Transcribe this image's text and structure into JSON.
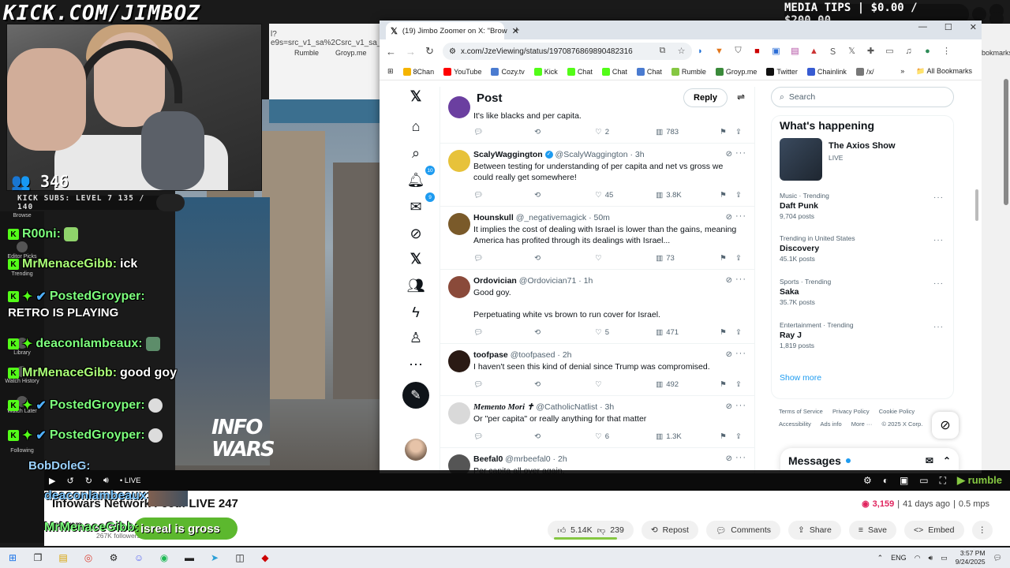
{
  "overlay": {
    "title": "KICK.COM/JIMBOZ",
    "viewer_count": "346",
    "subs_bar": "KICK SUBS: LEVEL 7  135 / 140",
    "media_tips": "MEDIA TIPS | $0.00 / $200.00",
    "retro_text": "RETRO IS PLAYING",
    "infowars_logo": "INFO WARS"
  },
  "chat_sidebar": [
    {
      "label": "Browse"
    },
    {
      "label": "Editor Picks"
    },
    {
      "label": "Trending"
    },
    {
      "label": "Library"
    },
    {
      "label": "Watch History"
    },
    {
      "label": "Watch Later"
    },
    {
      "label": "Following"
    }
  ],
  "chat": [
    {
      "name": "R00ni:",
      "msg": ""
    },
    {
      "name": "MrMenaceGibb:",
      "msg": "ick"
    },
    {
      "name": "PostedGroyper:",
      "msg": ""
    },
    {
      "name": "deaconlambeaux:",
      "msg": ""
    },
    {
      "name": "MrMenaceGibb:",
      "msg": "good goy"
    },
    {
      "name": "PostedGroyper:",
      "msg": ""
    },
    {
      "name": "PostedGroyper:",
      "msg": ""
    },
    {
      "name": "BobDoleG:",
      "msg": ""
    },
    {
      "name": "deaconlambeaux:",
      "msg": ""
    },
    {
      "name": "MrMenaceGibb:",
      "msg": "isreal is gross"
    }
  ],
  "behind_page": {
    "url_fragment": "l?e9s=src_v1_sa%2Csrc_v1_sa_m%",
    "bookmarks": [
      "Rumble",
      "Groyp.me"
    ],
    "right_fragment": "bokmarks"
  },
  "browser": {
    "tab_title": "(19) Jimbo Zoomer on X: \"Brow",
    "url": "x.com/JzeViewing/status/1970876869890482316",
    "bookmarks": [
      "8Chan",
      "YouTube",
      "Cozy.tv",
      "Kick",
      "Chat",
      "Chat",
      "Chat",
      "Rumble",
      "Groyp.me",
      "Twitter",
      "Chainlink",
      "/x/"
    ],
    "all_bookmarks": "All Bookmarks"
  },
  "x": {
    "header_title": "Post",
    "reply_label": "Reply",
    "notif_badge": "10",
    "messages_badge": "9",
    "tweets": [
      {
        "name": "",
        "handle": "",
        "time": "",
        "text": "It's like blacks and per capita.",
        "replies": "",
        "retweets": "",
        "likes": "2",
        "views": "783"
      },
      {
        "name": "ScalyWaggington",
        "handle": "@ScalyWaggington",
        "time": "3h",
        "text": "Between testing for understanding of per capita and net vs gross we could really get somewhere!",
        "replies": "",
        "retweets": "",
        "likes": "45",
        "views": "3.8K",
        "verified": true
      },
      {
        "name": "Hounskull",
        "handle": "@_negativemagick",
        "time": "50m",
        "text": "It implies the cost of dealing with Israel is lower than the gains, meaning America has profited through its dealings with Israel...",
        "replies": "",
        "retweets": "",
        "likes": "",
        "views": "73"
      },
      {
        "name": "Ordovician",
        "handle": "@Ordovician71",
        "time": "1h",
        "text": "Good goy.\n\nPerpetuating white vs brown to run cover for Israel.",
        "replies": "",
        "retweets": "",
        "likes": "5",
        "views": "471"
      },
      {
        "name": "toofpase",
        "handle": "@toofpased",
        "time": "2h",
        "text": "I haven't seen this kind of denial since Trump was compromised.",
        "replies": "",
        "retweets": "",
        "likes": "",
        "views": "492"
      },
      {
        "name": "Memento Mori ✝",
        "handle": "@CatholicNatlist",
        "time": "3h",
        "text": "Or \"per capita\" or really anything for that matter",
        "replies": "",
        "retweets": "",
        "likes": "6",
        "views": "1.3K"
      },
      {
        "name": "Beefal0",
        "handle": "@mrbeefal0",
        "time": "2h",
        "text": "Per capita all over again.",
        "replies": "",
        "retweets": "",
        "likes": "",
        "views": ""
      }
    ],
    "search_placeholder": "Search",
    "whats_happening": "What's happening",
    "axios": {
      "name": "The Axios Show",
      "status": "LIVE"
    },
    "trends": [
      {
        "category": "Music · Trending",
        "name": "Daft Punk",
        "posts": "9,704 posts"
      },
      {
        "category": "Trending in United States",
        "name": "Discovery",
        "posts": "45.1K posts"
      },
      {
        "category": "Sports · Trending",
        "name": "Saka",
        "posts": "35.7K posts"
      },
      {
        "category": "Entertainment · Trending",
        "name": "Ray J",
        "posts": "1,819 posts"
      }
    ],
    "show_more": "Show more",
    "footer": [
      "Terms of Service",
      "Privacy Policy",
      "Cookie Policy",
      "Accessibility",
      "Ads info",
      "More ···",
      "© 2025 X Corp."
    ],
    "messages_label": "Messages"
  },
  "player": {
    "live_label": "• LIVE",
    "brand": "rumble"
  },
  "video": {
    "title": "Infowars Network Feed: LIVE 247",
    "views": "3,159",
    "ago": "41 days ago",
    "rate": "0.5 mps",
    "channel": "Infowars",
    "followers": "267K followers",
    "upvotes": "5.14K",
    "downvotes": "239",
    "buttons": [
      "Repost",
      "Comments",
      "Share",
      "Save",
      "Embed"
    ]
  },
  "taskbar": {
    "lang": "ENG",
    "time": "3:57 PM",
    "date": "9/24/2025"
  }
}
